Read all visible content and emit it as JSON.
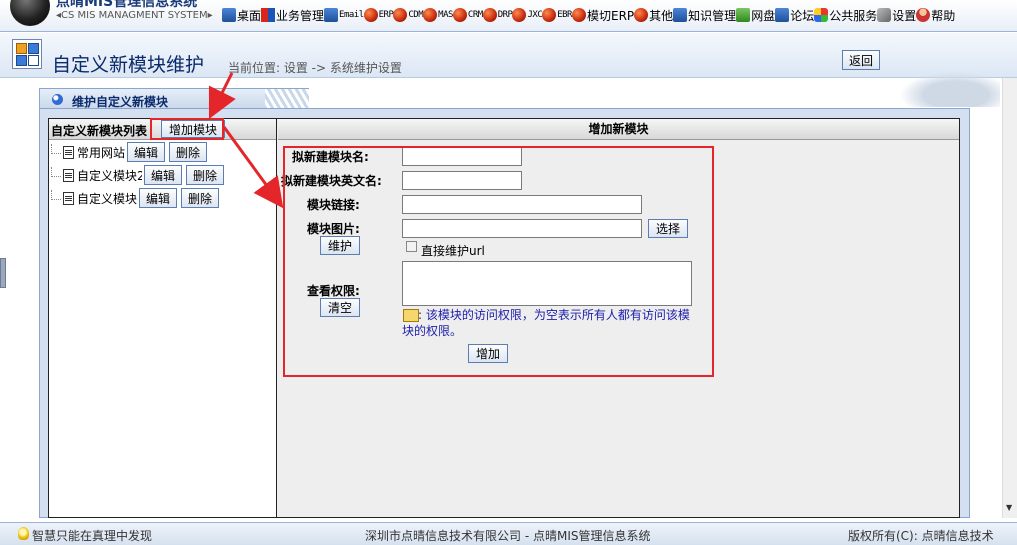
{
  "app": {
    "title": "点晴MIS管理信息系统",
    "subtitle": "◂CS MIS MANAGMENT SYSTEM▸"
  },
  "topnav": [
    {
      "label": "桌面",
      "icon": "desktop-icon",
      "style": "sq"
    },
    {
      "label": "业务管理",
      "icon": "business-icon",
      "style": "flag"
    },
    {
      "label": "Email",
      "icon": "email-icon",
      "style": "sq",
      "small": true
    },
    {
      "label": "ERP",
      "icon": "erp-icon",
      "style": "ball",
      "small": true
    },
    {
      "label": "CDM",
      "icon": "cdm-icon",
      "style": "ball",
      "small": true
    },
    {
      "label": "MAS",
      "icon": "mas-icon",
      "style": "ball",
      "small": true
    },
    {
      "label": "CRM",
      "icon": "crm-icon",
      "style": "ball",
      "small": true
    },
    {
      "label": "DRP",
      "icon": "drp-icon",
      "style": "ball",
      "small": true
    },
    {
      "label": "JXC",
      "icon": "jxc-icon",
      "style": "ball",
      "small": true
    },
    {
      "label": "EBR",
      "icon": "ebr-icon",
      "style": "ball",
      "small": true
    },
    {
      "label": "模切ERP",
      "icon": "diecut-erp-icon",
      "style": "ball",
      "small": false
    },
    {
      "label": "其他",
      "icon": "other-icon",
      "style": "ball"
    },
    {
      "label": "知识管理",
      "icon": "knowledge-icon",
      "style": "sq"
    },
    {
      "label": "网盘",
      "icon": "netdisk-icon",
      "style": "grn"
    },
    {
      "label": "论坛",
      "icon": "forum-icon",
      "style": "sq"
    },
    {
      "label": "公共服务",
      "icon": "public-service-icon",
      "style": "multi"
    },
    {
      "label": "设置",
      "icon": "settings-icon",
      "style": "wrench"
    },
    {
      "label": "帮助",
      "icon": "help-icon",
      "style": "user"
    }
  ],
  "header": {
    "title": "自定义新模块维护",
    "breadcrumb": "当前位置: 设置 -> 系统维护设置",
    "back_label": "返回"
  },
  "panel": {
    "tab_label": "维护自定义新模块",
    "left_header": "自定义新模块列表",
    "add_module_label": "增加模块",
    "tree": [
      {
        "label": "常用网站",
        "edit": "编辑",
        "delete": "删除"
      },
      {
        "label": "自定义模块2",
        "edit": "编辑",
        "delete": "删除"
      },
      {
        "label": "自定义模块",
        "edit": "编辑",
        "delete": "删除"
      }
    ],
    "right_header": "增加新模块"
  },
  "form": {
    "name_label": "拟新建模块名:",
    "name_value": "",
    "en_name_label": "拟新建模块英文名:",
    "en_name_value": "",
    "link_label": "模块链接:",
    "link_value": "",
    "image_label": "模块图片:",
    "image_value": "",
    "select_label": "选择",
    "maintain_label": "维护",
    "direct_url_label": "直接维护url",
    "direct_url_checked": false,
    "perm_label": "查看权限:",
    "clear_label": "清空",
    "perm_value": "",
    "hint": ": 该模块的访问权限，为空表示所有人都有访问该模块的权限。",
    "submit_label": "增加"
  },
  "footer": {
    "left": "智慧只能在真理中发现",
    "center": "深圳市点晴信息技术有限公司 - 点晴MIS管理信息系统",
    "right": "版权所有(C): 点晴信息技术"
  },
  "colors": {
    "annotation_red": "#e4262b",
    "panel_blue": "#d4e0ef",
    "title_blue": "#0a2a6b"
  }
}
